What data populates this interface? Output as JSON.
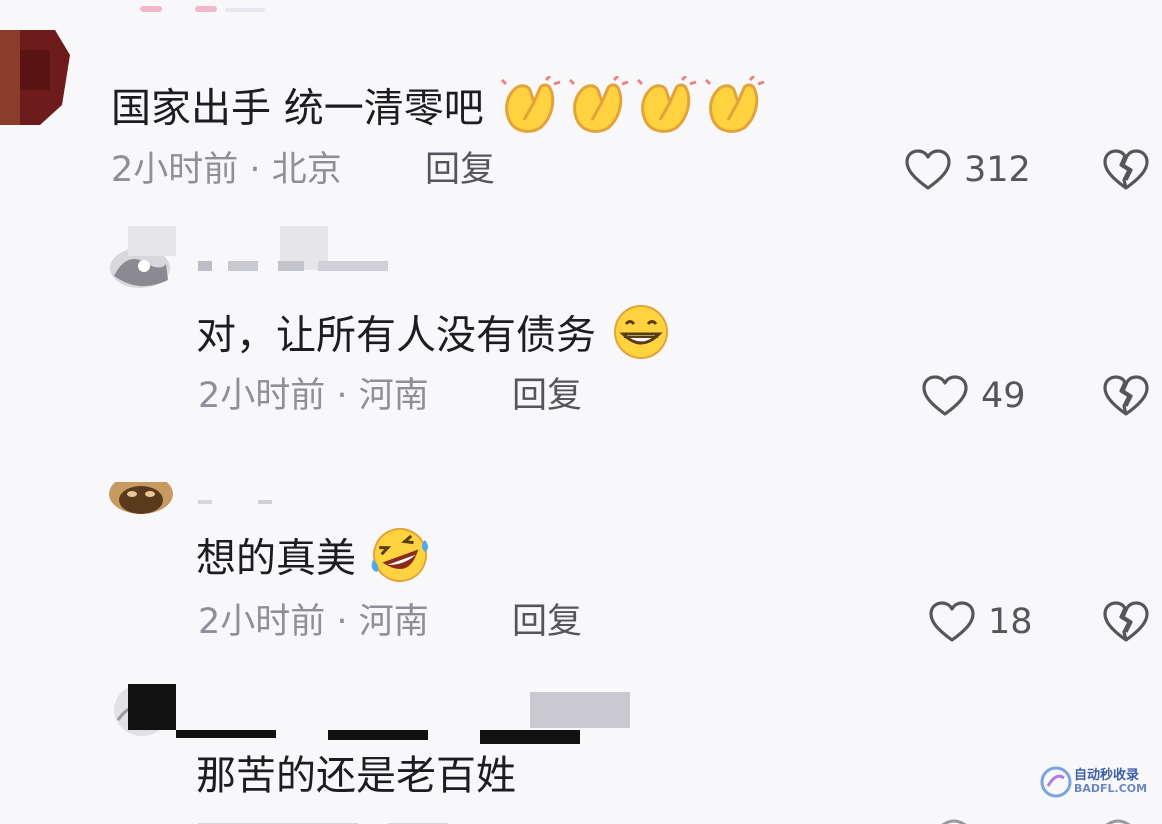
{
  "comments": [
    {
      "text": "国家出手 统一清零吧",
      "emoji": [
        "clapping-hands",
        "clapping-hands",
        "clapping-hands",
        "clapping-hands"
      ],
      "time": "2小时前",
      "dot": "·",
      "location": "北京",
      "reply_label": "回复",
      "likes": "312"
    },
    {
      "text": "对，让所有人没有债务",
      "emoji": [
        "grinning-face"
      ],
      "time": "2小时前",
      "dot": "·",
      "location": "河南",
      "reply_label": "回复",
      "likes": "49"
    },
    {
      "text": "想的真美",
      "emoji": [
        "rolling-laughing-face"
      ],
      "time": "2小时前",
      "dot": "·",
      "location": "河南",
      "reply_label": "回复",
      "likes": "18"
    },
    {
      "text": "那苦的还是老百姓"
    }
  ],
  "watermark": {
    "line1": "自动秒收录",
    "line2": "BADFL.COM"
  },
  "colors": {
    "background": "#f8f8fb",
    "text": "#1c1c22",
    "meta": "#8f8f98",
    "icon": "#55555c"
  }
}
